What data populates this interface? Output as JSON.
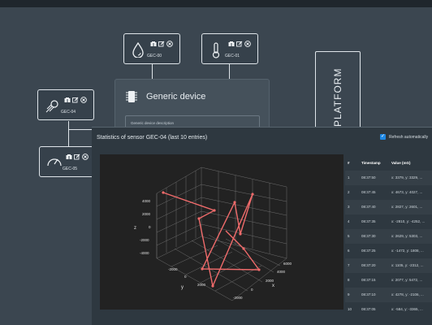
{
  "sensors": [
    {
      "id": "GEC-00",
      "icon": "water-drop-icon"
    },
    {
      "id": "GEC-01",
      "icon": "thermometer-icon"
    },
    {
      "id": "GEC-04",
      "icon": "meteor-icon"
    },
    {
      "id": "GEC-05",
      "icon": "speedometer-icon"
    }
  ],
  "device": {
    "title": "Generic device",
    "description": "Generic device description"
  },
  "platform": {
    "label": "PLATFORM"
  },
  "stats_window": {
    "title": "Statistics of sensor GEC-04 (last 10 entries)",
    "refresh_label": "Refresh automatically",
    "refresh_checked": true
  },
  "table": {
    "headers": [
      "#",
      "Timestamp",
      "Value (mG)"
    ],
    "rows": [
      {
        "n": "1",
        "time": "08:37:50",
        "value": "x: 3379, y: 3329, ..."
      },
      {
        "n": "2",
        "time": "08:37:45",
        "value": "x: 4673, y: 4027, ..."
      },
      {
        "n": "3",
        "time": "08:37:40",
        "value": "x: 2827, y: 2601, ..."
      },
      {
        "n": "4",
        "time": "08:37:35",
        "value": "x: -2810, y: -4252, ..."
      },
      {
        "n": "5",
        "time": "08:37:30",
        "value": "x: 2629, y: 5303, ..."
      },
      {
        "n": "6",
        "time": "08:37:25",
        "value": "x: -1472, y: 1808, ..."
      },
      {
        "n": "7",
        "time": "08:37:20",
        "value": "x: 1105, y: -2312, ..."
      },
      {
        "n": "8",
        "time": "08:37:15",
        "value": "x: 2077, y: 5472, ..."
      },
      {
        "n": "9",
        "time": "08:37:10",
        "value": "x: 4278, y: -2106, ..."
      },
      {
        "n": "10",
        "time": "08:37:05",
        "value": "x: -584, y: -3365, ..."
      }
    ]
  },
  "plot": {
    "z_label": "z",
    "y_label": "y",
    "x_label": "x",
    "z_ticks": [
      "4000",
      "2000",
      "0",
      "-2000",
      "-4000"
    ],
    "y_ticks": [
      "-2000",
      "0",
      "2000"
    ],
    "x_ticks": [
      "-2000",
      "0",
      "2000",
      "4000",
      "6000"
    ],
    "trace_color": "#f06b6b"
  },
  "colors": {
    "accent": "#1e88e5",
    "background": "#3b4650"
  }
}
